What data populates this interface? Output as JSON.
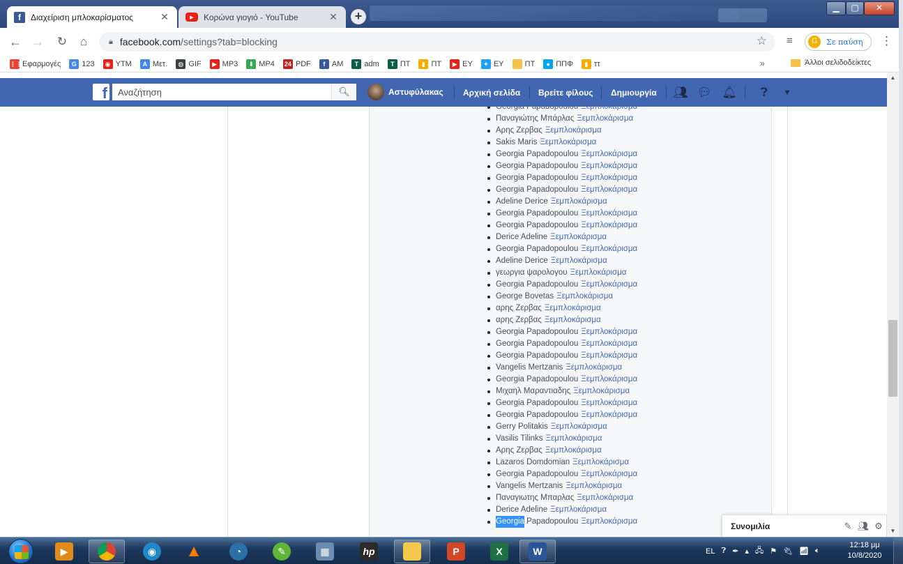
{
  "browser": {
    "tabs": [
      {
        "title": "Διαχείριση μπλοκαρίσματος",
        "favicon": "facebook-icon",
        "close": "✕"
      },
      {
        "title": "Κορώνα γιογιό - YouTube",
        "favicon": "youtube-icon",
        "close": "✕"
      }
    ],
    "new_tab": "+",
    "url_host": "facebook.com",
    "url_path": "/settings?tab=blocking",
    "profile_status": "Σε παύση",
    "profile_initial": "G"
  },
  "bookmarks": [
    {
      "label": "Εφαρμογές",
      "icon": "apps-grid-icon",
      "color": "#ea4335"
    },
    {
      "label": "123",
      "icon": "google-icon",
      "color": "#4285f4"
    },
    {
      "label": "YTM",
      "icon": "youtube-music-icon",
      "color": "#e62117"
    },
    {
      "label": "Μετ.",
      "icon": "translate-icon",
      "color": "#4285f4"
    },
    {
      "label": "GIF",
      "icon": "globe-icon",
      "color": "#3c4043"
    },
    {
      "label": "MP3",
      "icon": "youtube-icon",
      "color": "#e62117"
    },
    {
      "label": "MP4",
      "icon": "download-icon",
      "color": "#34a853"
    },
    {
      "label": "PDF",
      "icon": "pdf24-icon",
      "color": "#c5221f"
    },
    {
      "label": "AM",
      "icon": "facebook-icon",
      "color": "#3b5998"
    },
    {
      "label": "adm",
      "icon": "tt-icon",
      "color": "#0d5c4a"
    },
    {
      "label": "ΠΤ",
      "icon": "tt-icon",
      "color": "#0d5c4a"
    },
    {
      "label": "ΠΤ",
      "icon": "analytics-icon",
      "color": "#f9ab00"
    },
    {
      "label": "ΕΥ",
      "icon": "youtube-icon",
      "color": "#e62117"
    },
    {
      "label": "ΕΥ",
      "icon": "twitter-icon",
      "color": "#1da1f2"
    },
    {
      "label": "ΠΤ",
      "icon": "folder-icon",
      "color": "#f6c04a"
    },
    {
      "label": "ΠΠΦ",
      "icon": "meet-icon",
      "color": "#00a4ef"
    },
    {
      "label": "ττ",
      "icon": "analytics-icon",
      "color": "#f9ab00"
    }
  ],
  "bookmarks_more": "»",
  "bookmarks_other": "Άλλοι σελιδοδείκτες",
  "facebook": {
    "search_placeholder": "Αναζήτηση",
    "profile_name": "Αστυφύλακας",
    "nav_home": "Αρχική σελίδα",
    "nav_find_friends": "Βρείτε φίλους",
    "nav_create": "Δημιουργία"
  },
  "unblock_label": "Ξεμπλοκάρισμα",
  "blocked_users": [
    "Georgia Papadopoulou",
    "Παναγιώτης Μπάρλας",
    "Αρης Ζερβας",
    "Sakis Maris",
    "Georgia Papadopoulou",
    "Georgia Papadopoulou",
    "Georgia Papadopoulou",
    "Georgia Papadopoulou",
    "Adeline Derice",
    "Georgia Papadopoulou",
    "Georgia Papadopoulou",
    "Derice Adeline",
    "Georgia Papadopoulou",
    "Adeline Derice",
    "γεωργια ψαρολογου",
    "Georgia Papadopoulou",
    "George Bovetas",
    "αρης Ζερβας",
    "αρης Ζερβας",
    "Georgia Papadopoulou",
    "Georgia Papadopoulou",
    "Georgia Papadopoulou",
    "Vangelis Mertzanis",
    "Georgia Papadopoulou",
    "Μιχαηλ Μαραντιαδης",
    "Georgia Papadopoulou",
    "Georgia Papadopoulou",
    "Gerry Politakis",
    "Vasilis Tilinks",
    "Αρης Ζερβας",
    "Lazaros Domdomian",
    "Georgia Papadopoulou",
    "Vangelis Mertzanis",
    "Παναγιωτης Μπαρλας",
    "Derice Adeline"
  ],
  "last_user": {
    "highlighted": "Georgia",
    "rest": " Papadopoulou"
  },
  "chat": {
    "label": "Συνομιλία"
  },
  "taskbar": {
    "lang": "EL",
    "time": "12:18 μμ",
    "date": "10/8/2020"
  }
}
